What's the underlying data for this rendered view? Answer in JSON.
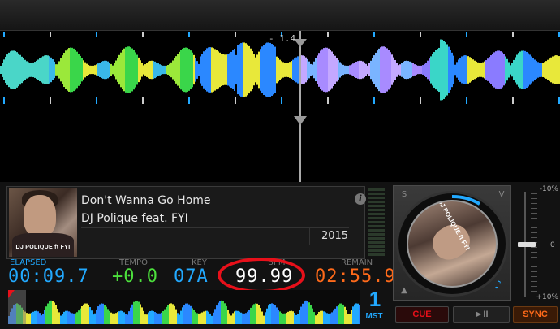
{
  "waveform": {
    "beat_readout": "- 1.4"
  },
  "track": {
    "title": "Don't Wanna Go Home",
    "artist": "DJ Polique feat. FYI",
    "year": "2015",
    "cover_text": "DJ POLIQUE ft FYI",
    "jog_cover_text": "DJ POLIQUE ft FYI"
  },
  "readouts": {
    "elapsed_label": "ELAPSED",
    "elapsed": "00:09.7",
    "tempo_label": "TEMPO",
    "tempo": "+0.0",
    "key_label": "KEY",
    "key": "07A",
    "bpm_label": "BPM",
    "bpm": "99.99",
    "remain_label": "REMAIN",
    "remain": "02:55.9"
  },
  "deck": {
    "number": "1",
    "mode": "MST"
  },
  "jog": {
    "s_label": "S",
    "v_label": "V"
  },
  "pitch": {
    "top": "-10%",
    "zero": "0",
    "bottom": "+10%"
  },
  "transport": {
    "cue": "CUE",
    "play": "►II",
    "sync": "SYNC"
  },
  "colors": {
    "accent": "#22a9ff",
    "tempo": "#4cdf3c",
    "remain": "#ff6a1a",
    "cue": "#e8101a",
    "highlight": "#e8101a"
  }
}
